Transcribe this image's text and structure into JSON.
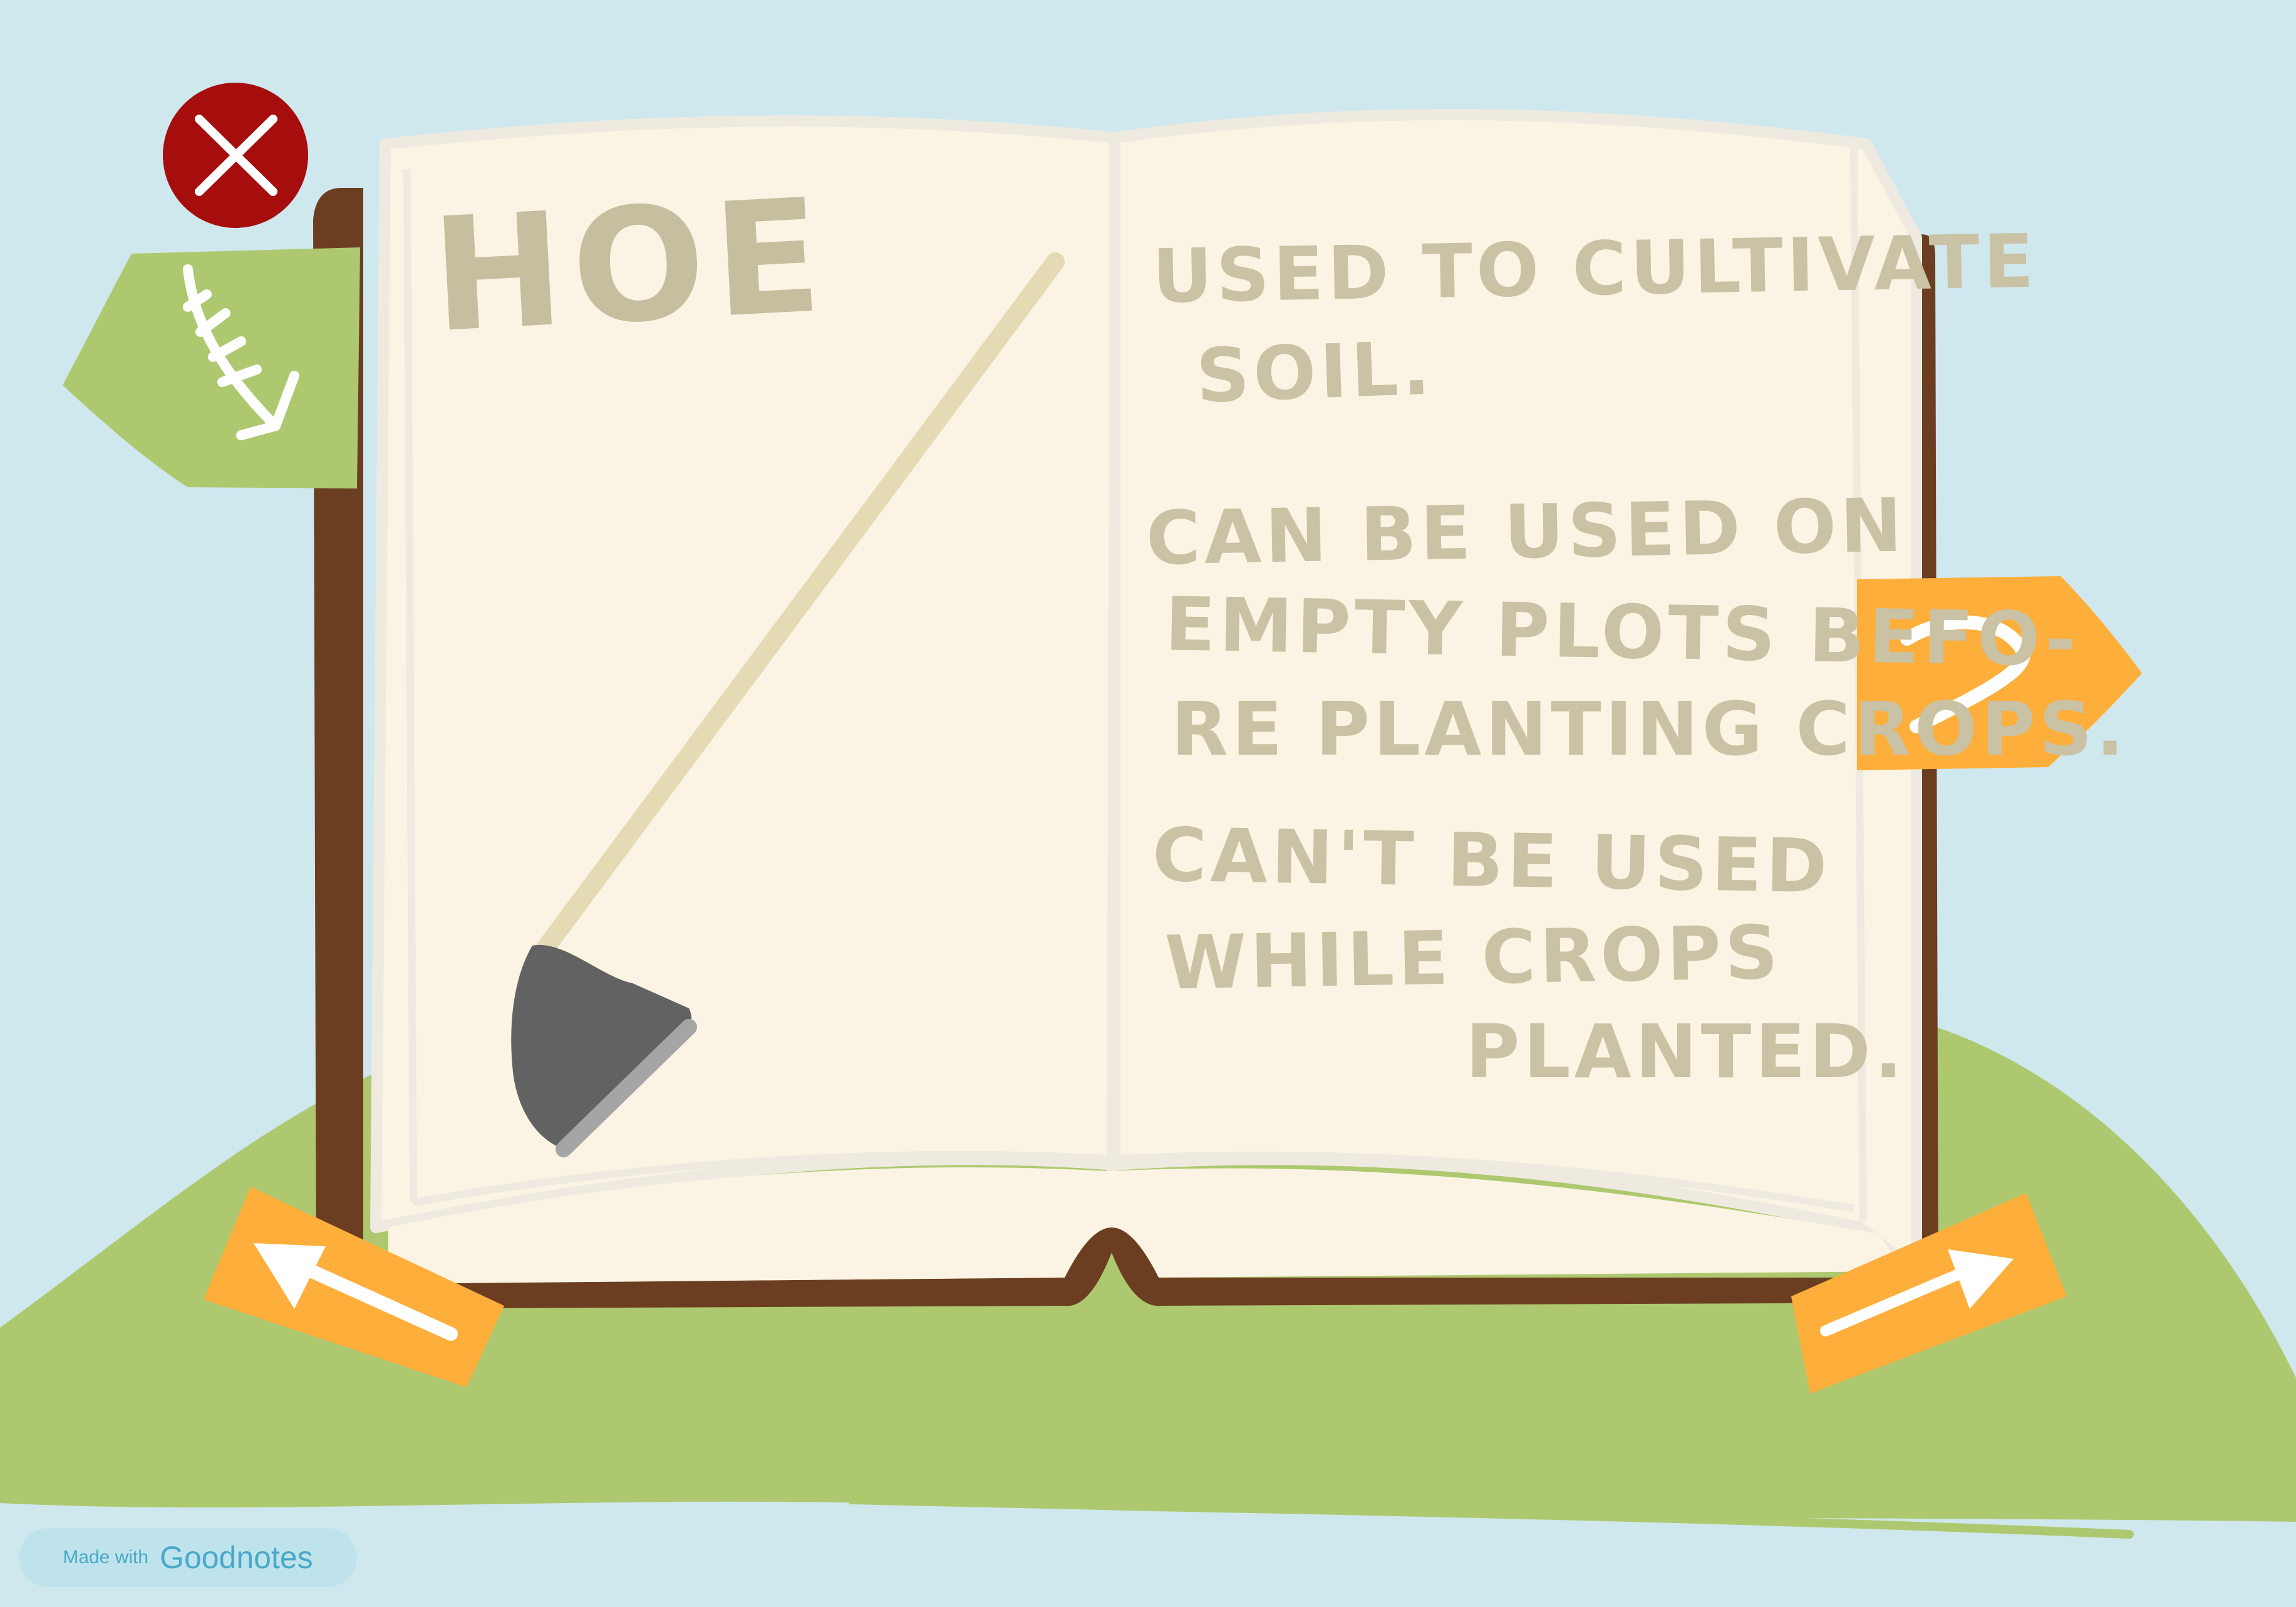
{
  "page": {
    "title": "HOE",
    "description_lines": [
      "USED TO CULTIVATE",
      "SOIL.",
      "CAN BE USED ON",
      "EMPTY PLOTS BEFO-",
      "RE PLANTING CROPS.",
      "CAN'T BE USED",
      "WHILE CROPS",
      "PLANTED."
    ]
  },
  "controls": {
    "close": {
      "icon": "close-icon"
    },
    "tab_left": {
      "icon": "arrow-down-icon"
    },
    "tab_right": {
      "icon": "question-icon"
    },
    "prev": {
      "icon": "arrow-up-left-icon"
    },
    "next": {
      "icon": "arrow-up-right-icon"
    }
  },
  "watermark": {
    "prefix": "Made with",
    "brand": "Goodnotes"
  },
  "colors": {
    "sky": "#cfe8ee",
    "grass": "#aec86f",
    "page": "#fbf4e4",
    "book_cover": "#6b3e22",
    "tab_green": "#aec86f",
    "tab_orange": "#feae3a",
    "close_red": "#a60d0d",
    "text": "#c9c2a4"
  }
}
